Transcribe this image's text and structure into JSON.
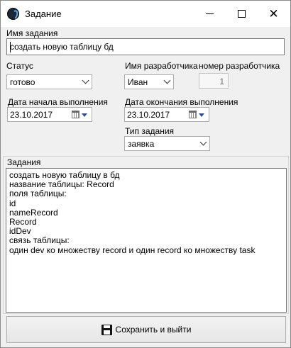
{
  "window": {
    "title": "Задание",
    "app_icon": "app-logo-icon",
    "controls": {
      "minimize_icon": "minimize-icon",
      "maximize_icon": "maximize-icon",
      "close_icon": "close-icon",
      "close_glyph": "✕"
    }
  },
  "form": {
    "task_name": {
      "label": "Имя задания",
      "value": "создать новую таблицу бд"
    },
    "status": {
      "label": "Статус",
      "value": "готово"
    },
    "developer_name": {
      "label": "Имя разработчика",
      "value": "Иван"
    },
    "developer_number": {
      "label": "номер разработчика",
      "value": "1"
    },
    "start_date": {
      "label": "Дата начала выполнения",
      "value": "23.10.2017"
    },
    "end_date": {
      "label": "Дата окончания выполнения",
      "value": "23.10.2017"
    },
    "task_type": {
      "label": "Тип задания",
      "value": "заявка"
    }
  },
  "tasks": {
    "label": "Задания",
    "lines": [
      "создать новую таблицу в бд",
      "название таблицы: Record",
      "поля таблицы:",
      "id",
      "nameRecord",
      "Record",
      "idDev",
      "связь таблицы:",
      "один dev ко множеству record и один record ко множеству task"
    ]
  },
  "save_button": {
    "label": "Сохранить и выйти",
    "icon": "floppy-disk-icon"
  }
}
